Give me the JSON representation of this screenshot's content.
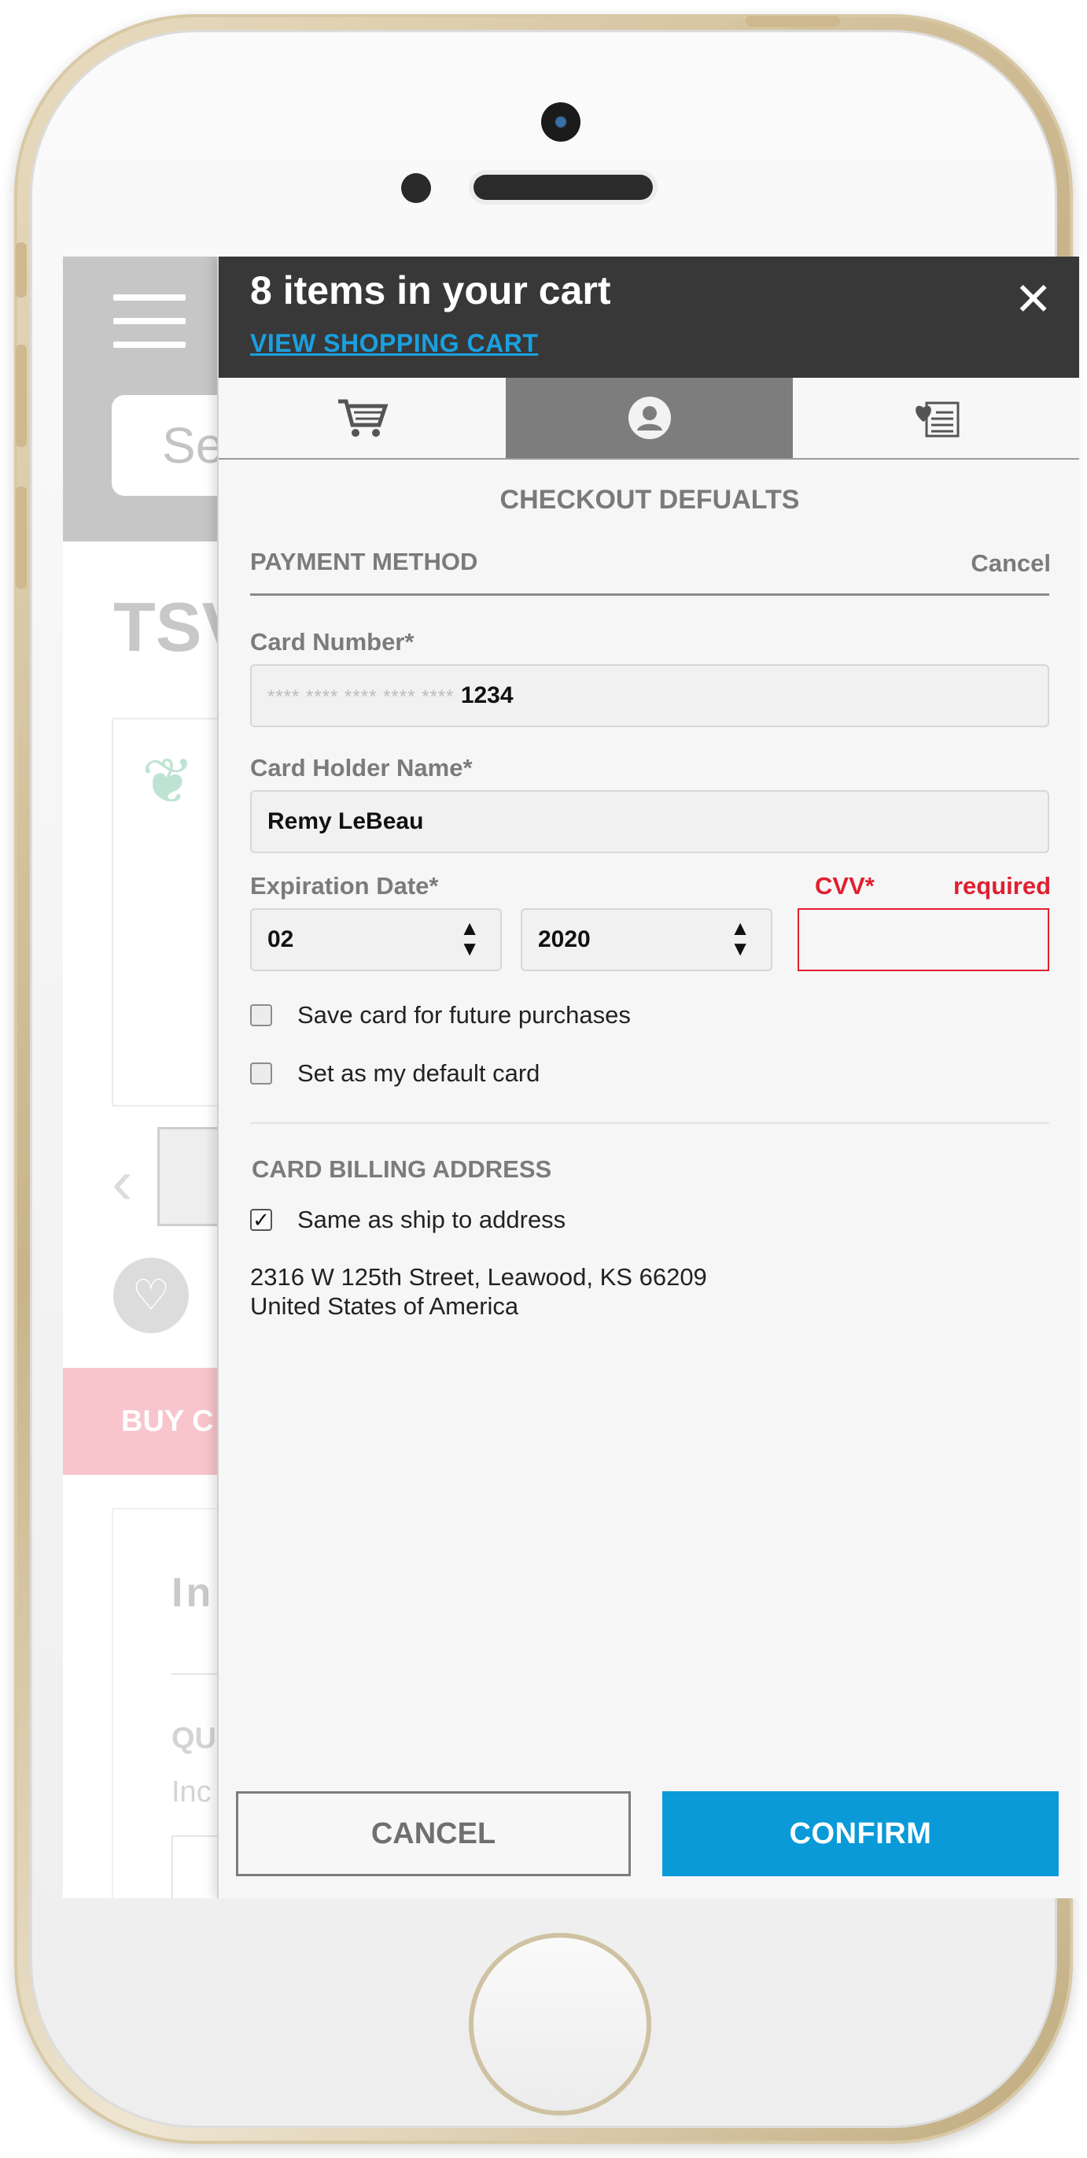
{
  "cart": {
    "items_title": "8 items in your cart",
    "view_cart_link": "VIEW SHOPPING CART",
    "close_glyph": "✕"
  },
  "tabs": [
    {
      "icon": "cart-icon",
      "active": false
    },
    {
      "icon": "user-icon",
      "active": true
    },
    {
      "icon": "wishlist-icon",
      "active": false
    }
  ],
  "checkout": {
    "title": "CHECKOUT DEFUALTS",
    "payment_method_label": "PAYMENT METHOD",
    "cancel_link": "Cancel"
  },
  "form": {
    "card_number_label": "Card Number*",
    "card_number_mask": "**** **** **** **** ****",
    "card_number_last4": "1234",
    "card_holder_label": "Card Holder Name*",
    "card_holder_value": "Remy LeBeau",
    "expiration_label": "Expiration Date*",
    "exp_month": "02",
    "exp_year": "2020",
    "cvv_label": "CVV*",
    "cvv_error": "required",
    "cvv_value": "",
    "save_card_label": "Save card for future purchases",
    "save_card_checked": false,
    "default_card_label": "Set as my default card",
    "default_card_checked": false
  },
  "billing": {
    "title": "CARD BILLING ADDRESS",
    "same_as_ship_label": "Same as ship to address",
    "same_as_ship_checked": true,
    "address_line1": "2316 W 125th Street, Leawood, KS 66209",
    "address_line2": "United States of America"
  },
  "actions": {
    "cancel_label": "CANCEL",
    "confirm_label": "CONFIRM"
  },
  "background_page": {
    "search_placeholder": "Se",
    "title_fragment": "TSV",
    "buy_fragment": "BUY C",
    "section_fragment": "In",
    "qty_fragment": "QU",
    "inc_fragment": "Inc"
  },
  "colors": {
    "header_bg": "#383838",
    "link_blue": "#1aa0e0",
    "confirm_blue": "#0a9ad8",
    "error_red": "#e02030",
    "active_tab": "#7d7d7d"
  }
}
